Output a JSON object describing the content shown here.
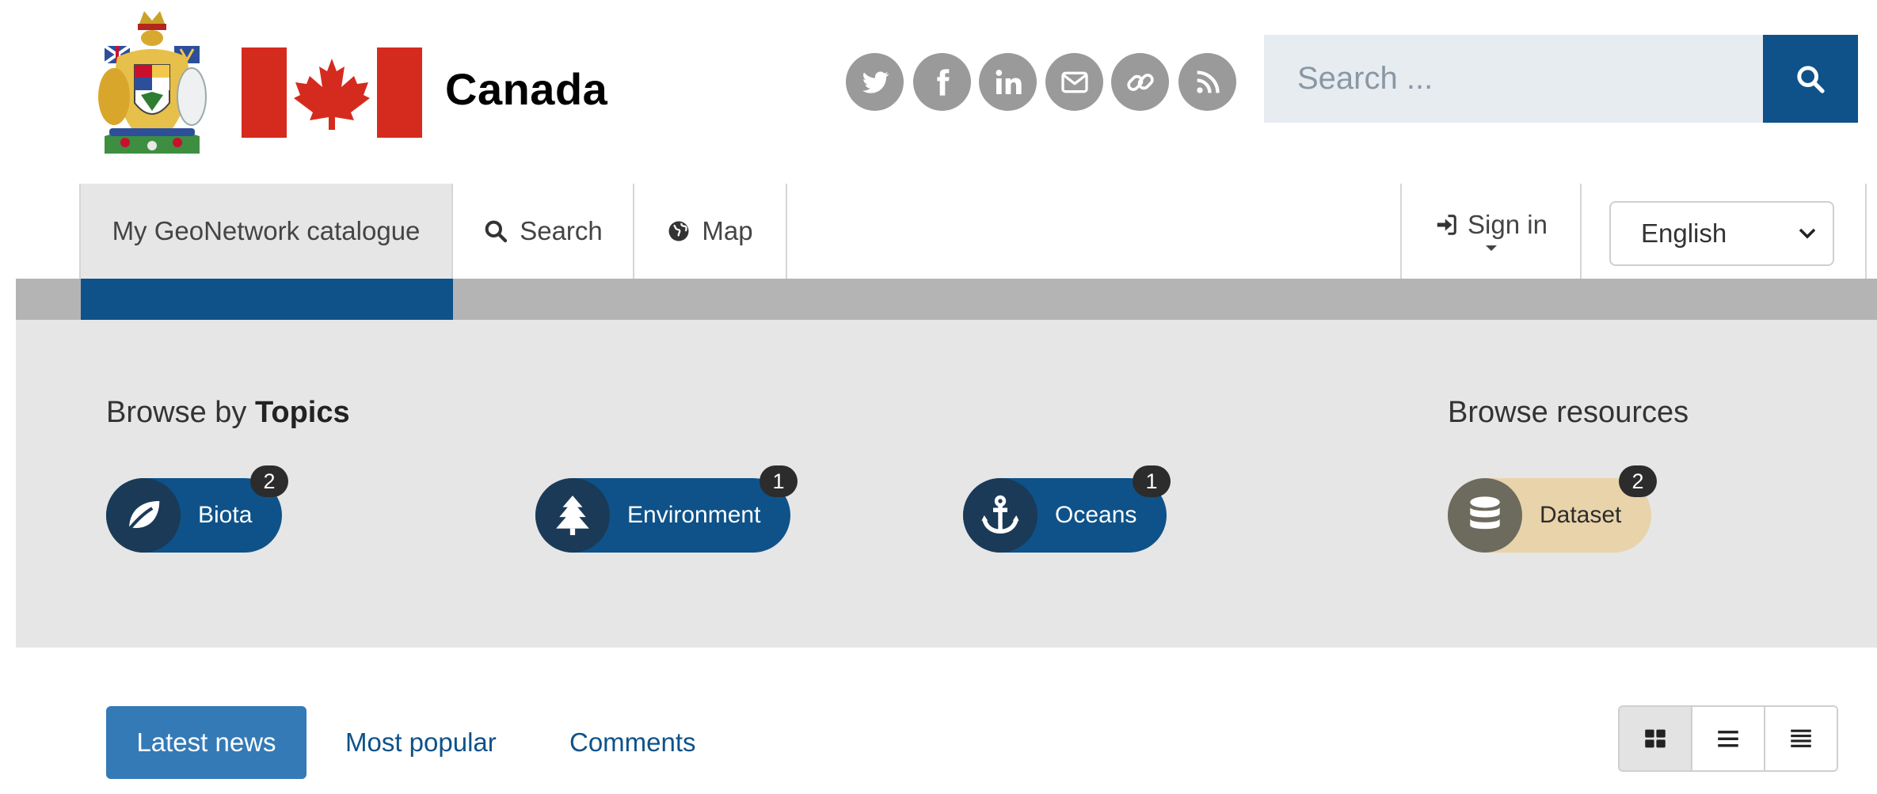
{
  "header": {
    "brand": "Canada",
    "coat_of_arms_icon": "canada-coat-of-arms-icon",
    "flag_icon": "canada-flag-icon",
    "social_icons": [
      "twitter-icon",
      "facebook-icon",
      "linkedin-icon",
      "email-icon",
      "link-icon",
      "rss-icon"
    ],
    "search_placeholder": "Search ...",
    "search_icon": "search-icon"
  },
  "nav": {
    "home_label": "My GeoNetwork catalogue",
    "search_label": "Search",
    "map_label": "Map",
    "signin_label": "Sign in",
    "language_selected": "English"
  },
  "browse": {
    "topics_prefix": "Browse by",
    "topics_strong": "Topics",
    "topics": [
      {
        "label": "Biota",
        "count": "2",
        "icon": "leaf-icon"
      },
      {
        "label": "Environment",
        "count": "1",
        "icon": "tree-icon"
      },
      {
        "label": "Oceans",
        "count": "1",
        "icon": "anchor-icon"
      }
    ],
    "resources_title": "Browse resources",
    "resources": [
      {
        "label": "Dataset",
        "count": "2",
        "icon": "database-icon"
      }
    ]
  },
  "tabs": {
    "latest": "Latest news",
    "popular": "Most popular",
    "comments": "Comments"
  },
  "view_modes": [
    "grid-view-icon",
    "list-view-icon",
    "compact-list-view-icon"
  ],
  "colors": {
    "brand_blue": "#0e5289",
    "canada_red": "#d52b1e",
    "dataset_tan": "#e9d3aa"
  }
}
